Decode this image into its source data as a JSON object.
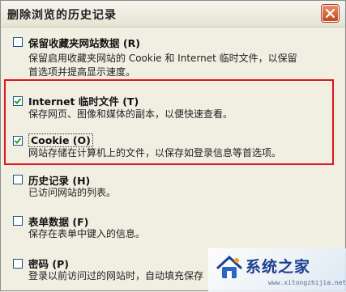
{
  "window": {
    "title": "删除浏览的历史记录"
  },
  "options": [
    {
      "title": "保留收藏夹网站数据 (R)",
      "checked": false,
      "desc": [
        "保留启用收藏夹网站的 Cookie 和 Internet 临时文件，以保留",
        "首选项并提高显示速度。"
      ]
    },
    {
      "title": "Internet 临时文件 (T)",
      "checked": true,
      "desc": [
        "保存网页、图像和媒体的副本，以便快速查看。"
      ]
    },
    {
      "title": "Cookie (O)",
      "checked": true,
      "desc": [
        "网站存储在计算机上的文件，以保存如登录信息等首选项。"
      ]
    },
    {
      "title": "历史记录 (H)",
      "checked": false,
      "desc": [
        "已访问网站的列表。"
      ]
    },
    {
      "title": "表单数据 (F)",
      "checked": false,
      "desc": [
        "保存在表单中键入的信息。"
      ]
    },
    {
      "title": "密码 (P)",
      "checked": false,
      "desc": [
        "登录以前访问过的网站时，自动填充保存"
      ]
    }
  ],
  "watermark": {
    "brand": "系统之家",
    "url": "www.xitongzhijia.net"
  },
  "colors": {
    "highlight": "#e0141c",
    "checkbox_border": "#1c5180",
    "check_mark": "#21a121",
    "close_button": "#c9431c"
  },
  "icons": {
    "close": "close-x-icon",
    "logo": "house-logo-icon"
  }
}
